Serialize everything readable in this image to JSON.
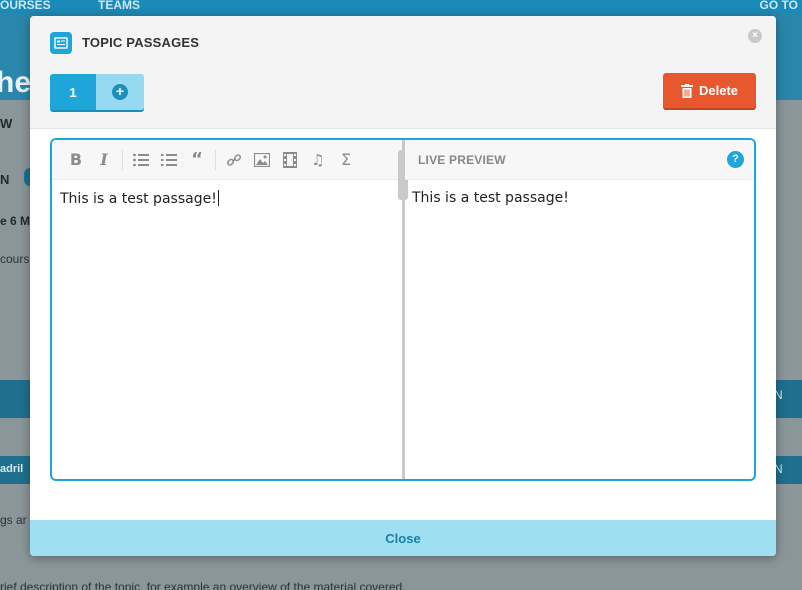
{
  "background": {
    "nav": {
      "courses": "OURSES",
      "teams": "TEAMS",
      "goto": "GO TO"
    },
    "header_fragment": "he",
    "fragments": {
      "w": "W",
      "n": "N",
      "e6m": "e 6 M",
      "cours": "cours",
      "quad": "adril",
      "gs": "gs ar",
      "desc": "rief description of the topic, for example an overview of the material covered.",
      "right1": "N",
      "right2": "N"
    }
  },
  "modal": {
    "title": "TOPIC PASSAGES",
    "title_icon": "document-list-icon",
    "close_icon": "close-circle-icon",
    "tabs": [
      {
        "label": "1"
      }
    ],
    "add_tab_icon": "plus-circle-icon",
    "delete_label": "Delete",
    "delete_icon": "trash-icon",
    "editor": {
      "toolbar": [
        "bold",
        "italic",
        "unordered-list",
        "ordered-list",
        "quote",
        "link",
        "image",
        "video",
        "audio",
        "formula"
      ],
      "content": "This is a test passage!"
    },
    "preview": {
      "label": "LIVE PREVIEW",
      "help_icon": "help-icon",
      "content": "This is a test passage!"
    },
    "footer": {
      "close_label": "Close"
    }
  },
  "colors": {
    "accent": "#1ea6d9",
    "delete": "#e8582f",
    "footer": "#9edff2"
  }
}
